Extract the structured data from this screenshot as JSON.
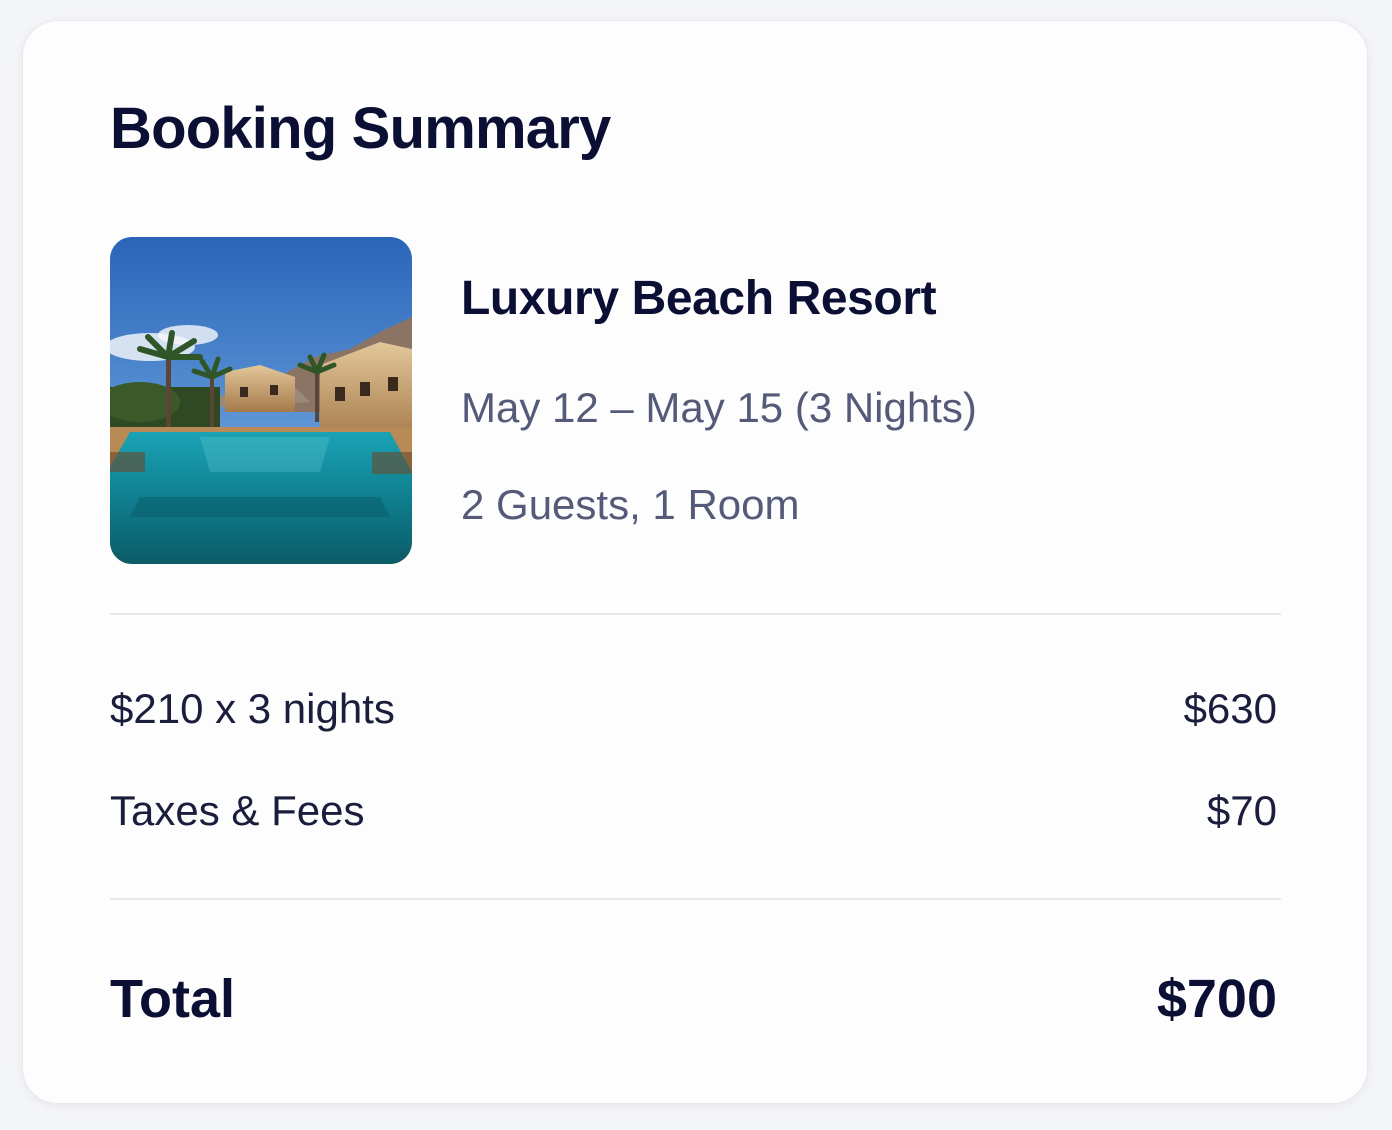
{
  "booking_summary": {
    "title": "Booking Summary",
    "hotel": {
      "name": "Luxury Beach Resort",
      "dates": "May 12 – May 15 (3 Nights)",
      "guests": "2 Guests, 1 Room",
      "image": "resort-pool-photo"
    },
    "line_items": [
      {
        "label": "$210 x 3 nights",
        "amount": "$630"
      },
      {
        "label": "Taxes & Fees",
        "amount": "$70"
      }
    ],
    "total": {
      "label": "Total",
      "amount": "$700"
    }
  },
  "colors": {
    "heading": "#0b0f33",
    "secondary_text": "#545a78",
    "divider": "#e7e8ee",
    "card_background": "#fdfdfe"
  }
}
